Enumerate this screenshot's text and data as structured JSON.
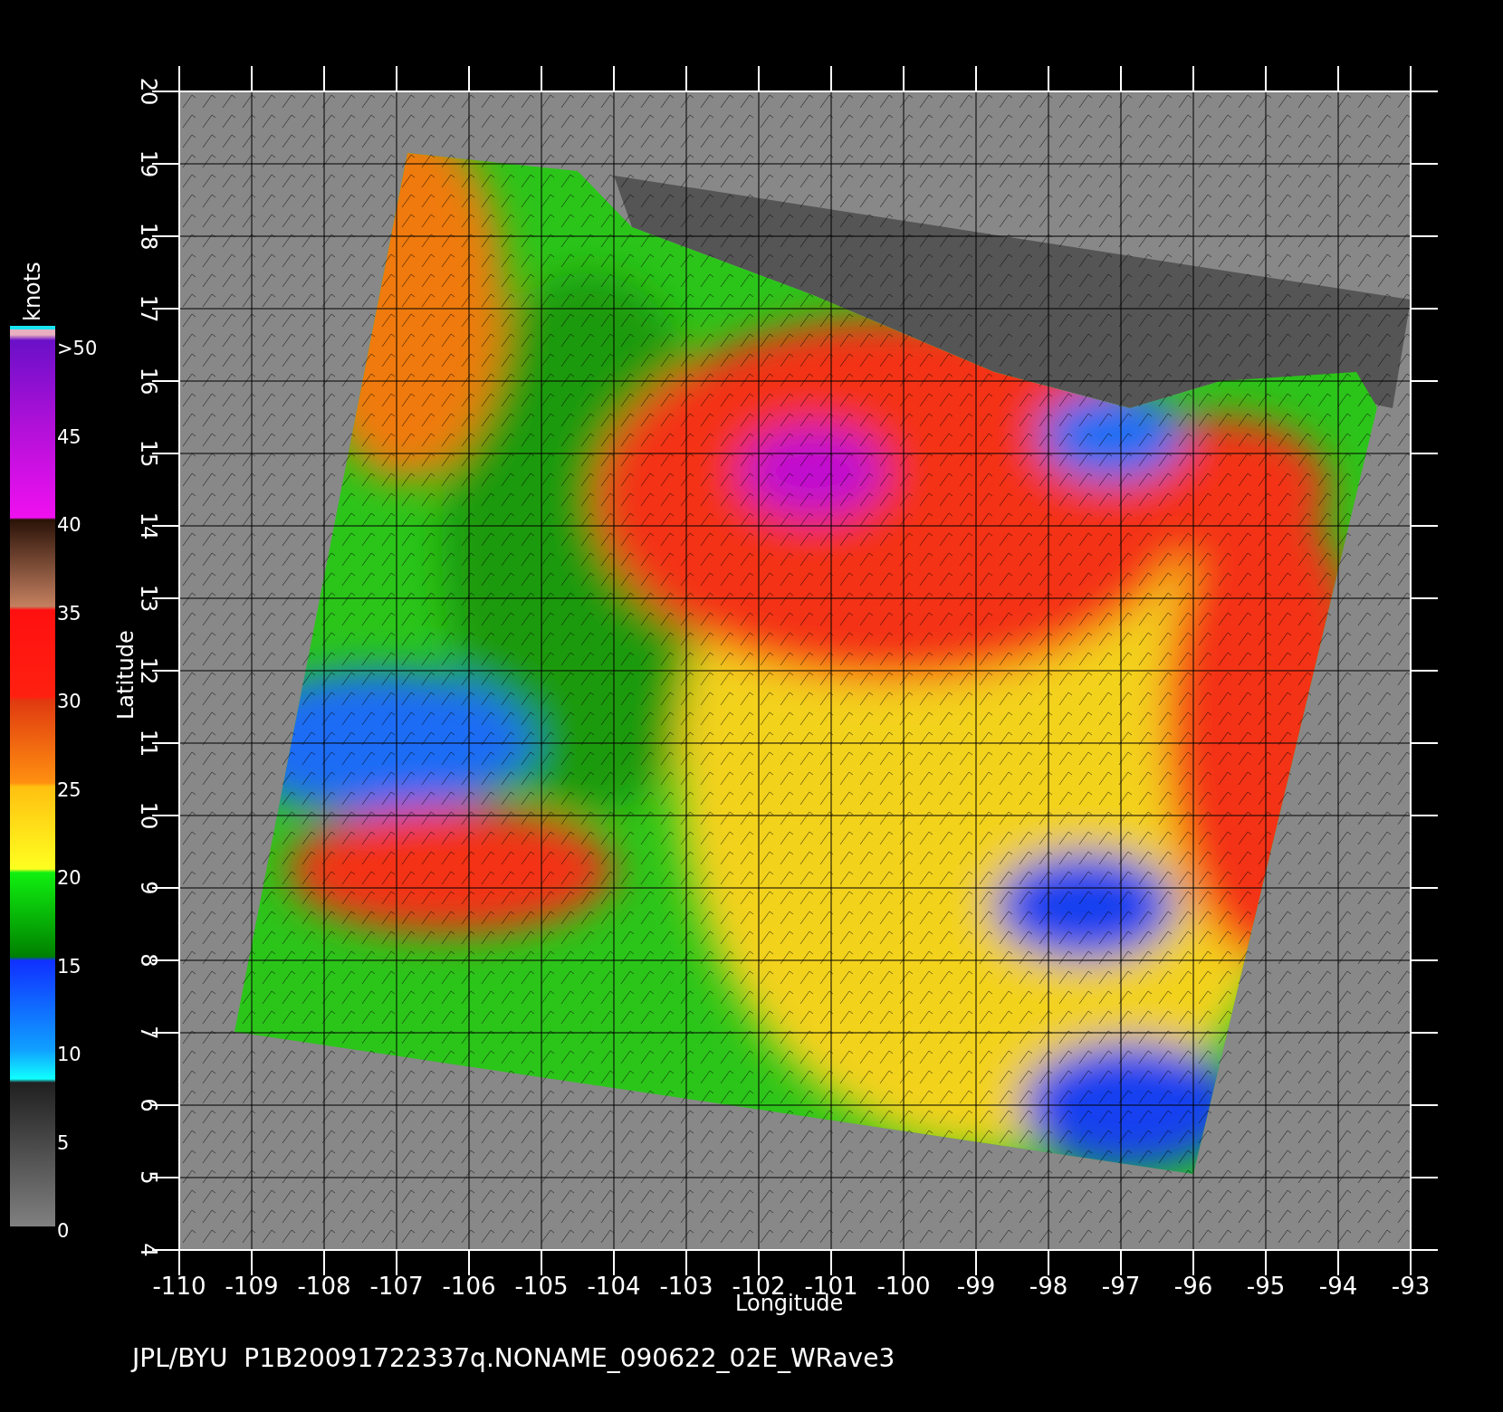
{
  "legend": {
    "unit": "knots",
    "labels": [
      ">50",
      "45",
      "40",
      "35",
      "30",
      "25",
      "20",
      "15",
      "10",
      "5",
      "0"
    ]
  },
  "plot": {
    "y_axis": {
      "title": "Latitude",
      "ticks": [
        "20",
        "19",
        "18",
        "17",
        "16",
        "15",
        "14",
        "13",
        "12",
        "11",
        "10",
        "9",
        "8",
        "7",
        "6",
        "5",
        "4"
      ]
    },
    "x_axis": {
      "title": "Longitude",
      "ticks": [
        "-110",
        "-109",
        "-108",
        "-107",
        "-106",
        "-105",
        "-104",
        "-103",
        "-102",
        "-101",
        "-100",
        "-99",
        "-98",
        "-97",
        "-96",
        "-95",
        "-94",
        "-93"
      ]
    }
  },
  "footer": "JPL/BYU  P1B20091722337q.NONAME_090622_02E_WRave3"
}
